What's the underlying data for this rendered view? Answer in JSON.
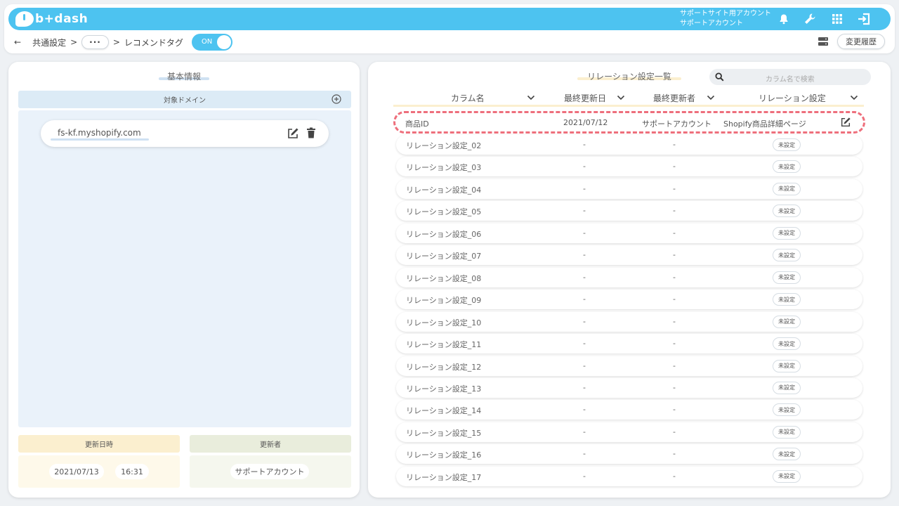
{
  "app": {
    "logo_text": "b+dash",
    "account_line1": "サポートサイト用アカウント",
    "account_line2": "サポートアカウント"
  },
  "nav": {
    "back": "←",
    "crumb1": "共通設定",
    "sep": ">",
    "dots": "···",
    "current": "レコメンドタグ",
    "toggle_label": "ON",
    "history_label": "変更履歴"
  },
  "basic": {
    "title": "基本情報",
    "domain_header": "対象ドメイン",
    "domain": "fs-kf.myshopify.com",
    "updated_label": "更新日時",
    "updated_date": "2021/07/13",
    "updated_time": "16:31",
    "updater_label": "更新者",
    "updater": "サポートアカウント"
  },
  "relations": {
    "title": "リレーション設定一覧",
    "search_placeholder": "カラム名で検索",
    "columns": [
      "カラム名",
      "最終更新日",
      "最終更新者",
      "リレーション設定"
    ],
    "first_row": {
      "name": "商品ID",
      "date": "2021/07/12",
      "user": "サポートアカウント",
      "setting": "Shopify商品詳細ページ"
    },
    "empty_mark": "-",
    "unset_label": "未設定",
    "rows": [
      "リレーション設定_02",
      "リレーション設定_03",
      "リレーション設定_04",
      "リレーション設定_05",
      "リレーション設定_06",
      "リレーション設定_07",
      "リレーション設定_08",
      "リレーション設定_09",
      "リレーション設定_10",
      "リレーション設定_11",
      "リレーション設定_12",
      "リレーション設定_13",
      "リレーション設定_14",
      "リレーション設定_15",
      "リレーション設定_16",
      "リレーション設定_17"
    ]
  },
  "colors": {
    "accent": "#4dc3f0",
    "highlight": "#ee6f7c"
  }
}
